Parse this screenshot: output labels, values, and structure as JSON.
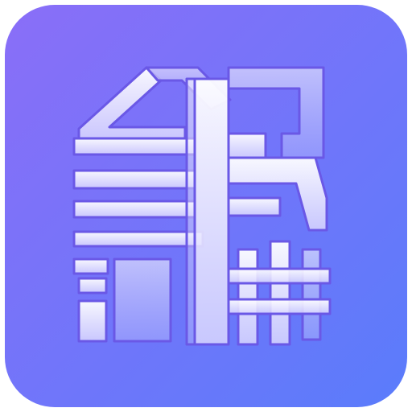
{
  "app_icon": {
    "logo_glyphs": [
      "全",
      "民",
      "讲",
      "解"
    ],
    "logo_text": "全民讲解",
    "colors": {
      "gradient_top_left": "#8a6ef8",
      "gradient_bottom_right": "#5a7cfb",
      "glyph_fill_light": "#ffffff",
      "glyph_fill_tint": "#d9d6ff",
      "glyph_stroke": "#6a58e6"
    }
  }
}
